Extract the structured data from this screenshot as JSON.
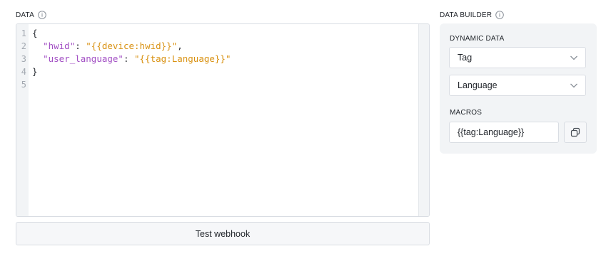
{
  "data_section": {
    "label": "DATA",
    "info_icon": "info-icon",
    "line_numbers": [
      "1",
      "2",
      "3",
      "4",
      "5"
    ],
    "code": {
      "line1_open": "{",
      "line2_key": "\"hwid\"",
      "line2_sep": ": ",
      "line2_value": "\"{{device:hwid}}\"",
      "line2_comma": ",",
      "line3_key": "\"user_language\"",
      "line3_sep": ": ",
      "line3_value": "\"{{tag:Language}}\"",
      "line4_close": "}",
      "line5": ""
    },
    "test_button_label": "Test webhook"
  },
  "builder": {
    "label": "DATA BUILDER",
    "info_icon": "info-icon",
    "dynamic_data_label": "DYNAMIC DATA",
    "type_select_value": "Tag",
    "field_select_value": "Language",
    "macros_label": "MACROS",
    "macro_value": "{{tag:Language}}",
    "copy_icon": "copy-icon"
  },
  "colors": {
    "json_key": "#a24fc4",
    "json_string": "#d99213",
    "panel_bg": "#f2f4f6"
  }
}
